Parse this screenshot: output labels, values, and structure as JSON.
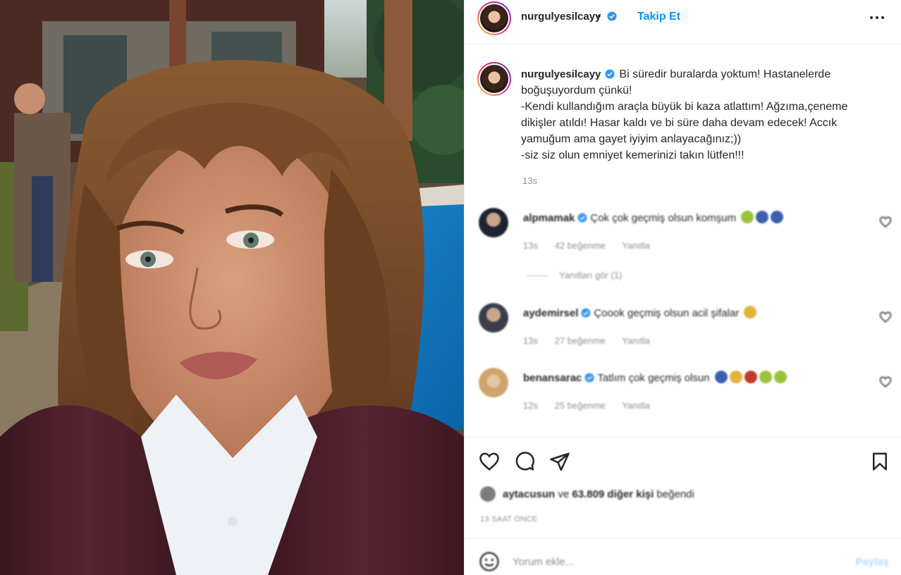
{
  "post": {
    "author": "nurgulyesilcayy",
    "follow_label": "Takip Et",
    "separator": "•",
    "caption_lines": [
      "Bi süredir buralarda yoktum! Hastanelerde",
      "boğuşuyordum çünkü!",
      "-Kendi kullandığım araçla büyük bi kaza atlattım! Ağzıma,çeneme",
      "dikişler atıldı! Hasar kaldı ve bi süre daha devam edecek! Accık",
      "yamuğum ama gayet iyiyim anlayacağınız;))",
      "-siz siz olun emniyet kemerinizi takın lütfen!!!"
    ],
    "caption_time": "13s"
  },
  "comments": [
    {
      "user": "alpmamak",
      "text": "Çok çok geçmiş olsun komşum",
      "time": "13s",
      "likes": "42 beğenme",
      "reply": "Yanıtla"
    },
    {
      "user": "aydemirsel",
      "text": "Çoook geçmiş olsun acil şifalar",
      "time": "13s",
      "likes": "27 beğenme",
      "reply": "Yanıtla"
    },
    {
      "user": "benansarac",
      "text": "Tatlım çok geçmiş olsun",
      "time": "12s",
      "likes": "25 beğenme",
      "reply": "Yanıtla"
    }
  ],
  "replies_label": "Yanıtları gör (1)",
  "likes": {
    "first_user": "aytacusun",
    "joiner": "ve",
    "others": "63.809 diğer kişi",
    "suffix": "beğendi"
  },
  "post_time": "13 SAAT ÖNCE",
  "add_comment": {
    "placeholder": "Yorum ekle...",
    "share_label": "Paylaş"
  },
  "icons": {
    "verified": "verified-badge-icon",
    "more": "more-options-icon",
    "like": "heart-icon",
    "comment": "comment-bubble-icon",
    "share": "paper-plane-icon",
    "save": "bookmark-icon",
    "emoji": "smiley-icon"
  },
  "colors": {
    "link_blue": "#0095f6",
    "verified_blue": "#3897f0",
    "muted": "#8e8e8e",
    "share_disabled": "#b2dffc"
  }
}
